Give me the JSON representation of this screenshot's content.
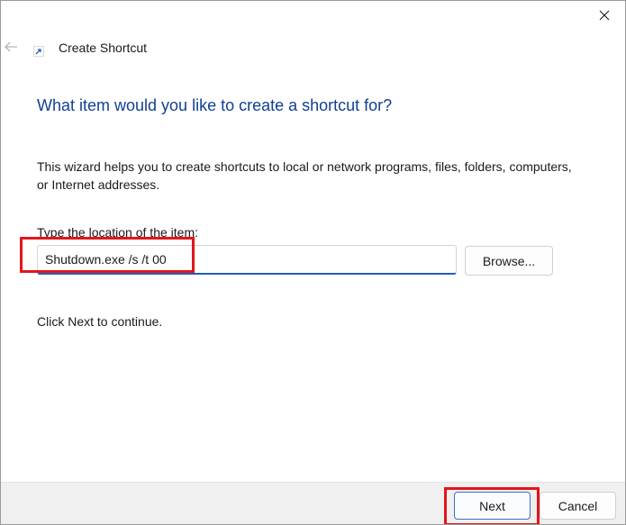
{
  "window": {
    "title": "Create Shortcut"
  },
  "icons": {
    "close": "close-icon",
    "back": "arrow-left-icon",
    "app": "shortcut-icon"
  },
  "main": {
    "heading": "What item would you like to create a shortcut for?",
    "description": "This wizard helps you to create shortcuts to local or network programs, files, folders, computers, or Internet addresses.",
    "location_label": "Type the location of the item:",
    "location_value": "Shutdown.exe /s /t 00",
    "browse_label": "Browse...",
    "continue_text": "Click Next to continue."
  },
  "footer": {
    "next_label": "Next",
    "cancel_label": "Cancel"
  },
  "colors": {
    "heading": "#123f95",
    "highlight": "#e3151b",
    "input_focus": "#1f5fb8"
  }
}
